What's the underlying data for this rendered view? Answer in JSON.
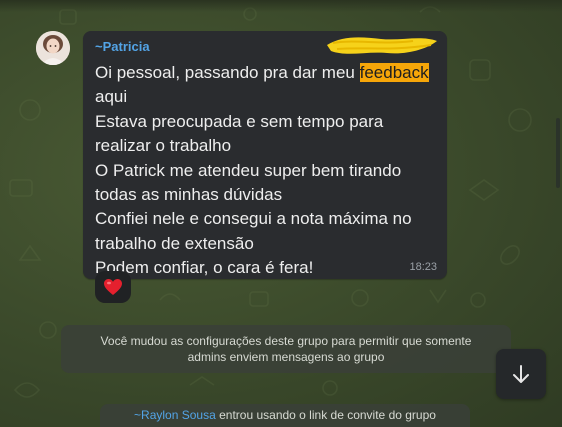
{
  "colors": {
    "wallpaper": "#3d4c2c",
    "bubble": "#2a2c2f",
    "sender_name": "#53a4e6",
    "highlight": "#f6a609",
    "message_text": "#eeeeee"
  },
  "message": {
    "sender": "~Patricia",
    "lines": {
      "l1_before": "Oi pessoal, passando pra dar meu ",
      "l1_highlight": "feedback",
      "l2": "aqui",
      "l3": "Estava preocupada e sem tempo para",
      "l4": "realizar o trabalho",
      "l5": "O Patrick me atendeu super bem tirando",
      "l6": "todas as minhas dúvidas",
      "l7": "Confiei nele e consegui a nota máxima no",
      "l8": "trabalho de extensão",
      "l9": "Podem confiar, o cara é fera!"
    },
    "time": "18:23",
    "reaction_icon": "heart-emoji"
  },
  "system_notice": {
    "line1": "Você mudou as configurações deste grupo para permitir que somente",
    "line2": "admins enviem mensagens ao grupo"
  },
  "join_notice": {
    "name": "~Raylon Sousa",
    "text": " entrou usando o link de convite do grupo"
  },
  "icons": {
    "scroll_down": "arrow-down-icon",
    "redaction": "yellow-scribble"
  }
}
